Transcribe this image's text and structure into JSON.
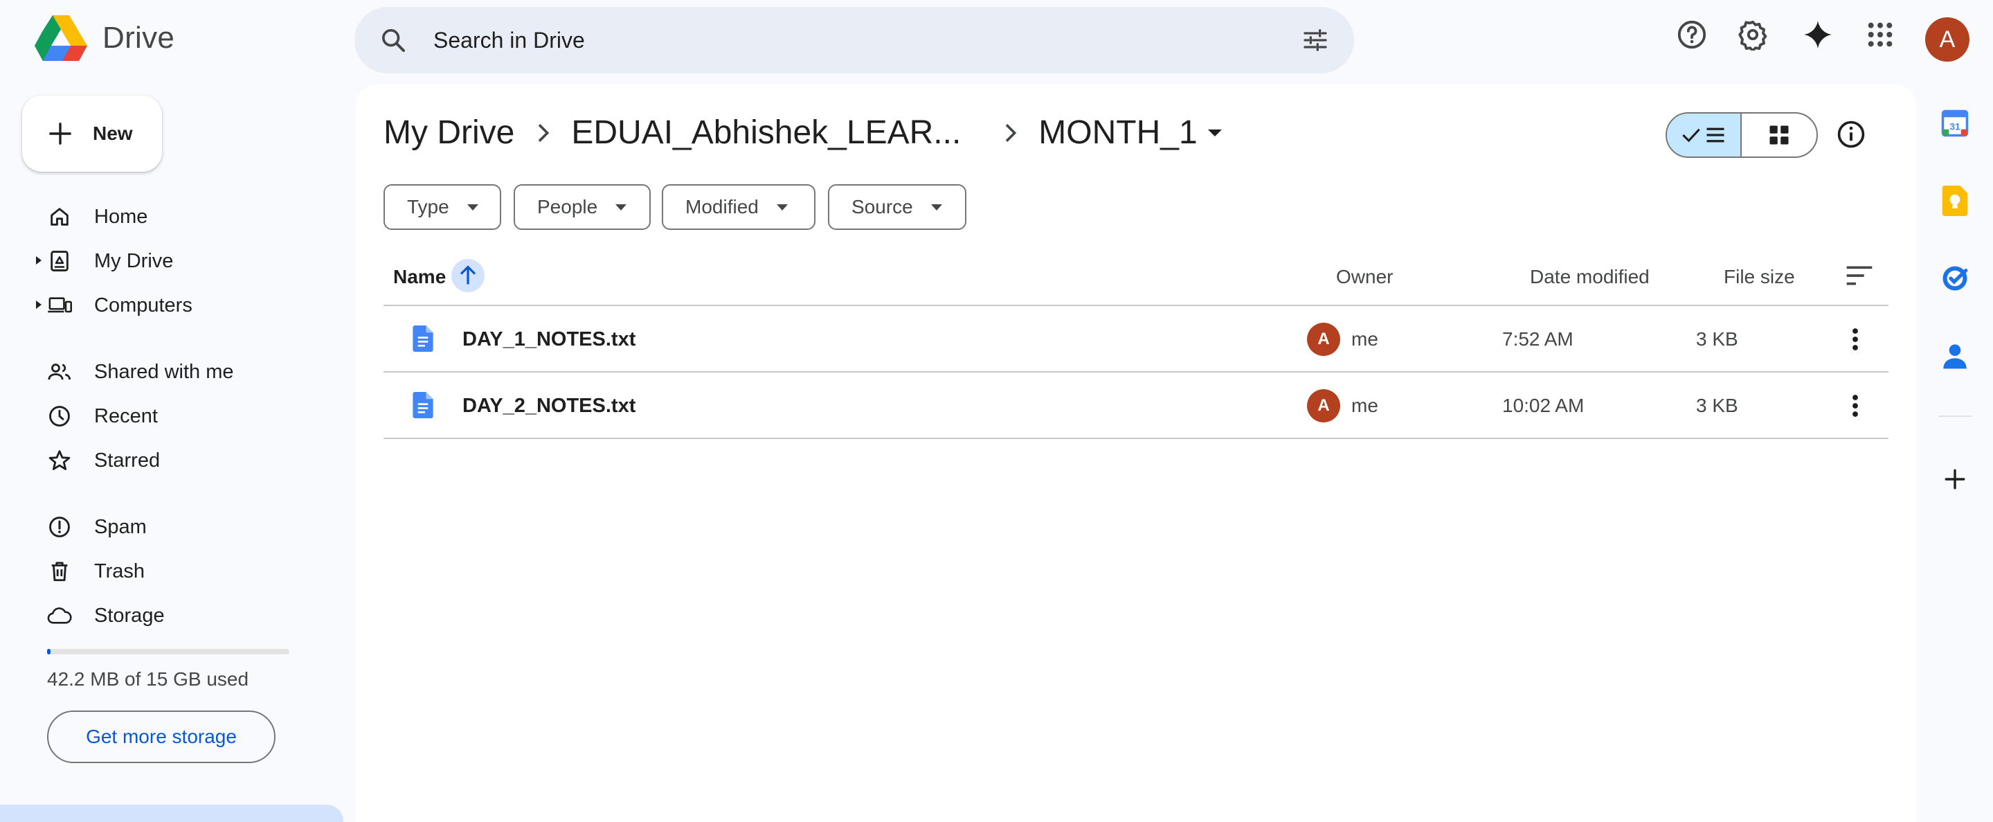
{
  "app": {
    "name": "Drive",
    "colors": {
      "accent": "#0b57d0",
      "selected": "#c2e7ff",
      "avatar": "#b3401f",
      "search_bg": "#e9eef6"
    }
  },
  "header": {
    "search_placeholder": "Search in Drive",
    "user_initial": "A",
    "icons": [
      "search-icon",
      "tune-icon",
      "help-icon",
      "settings-icon",
      "gemini-sparkle-icon",
      "apps-grid-icon"
    ]
  },
  "sidebar": {
    "new_label": "New",
    "items": [
      {
        "label": "Home",
        "icon": "home-icon"
      },
      {
        "label": "My Drive",
        "icon": "my-drive-icon",
        "expandable": true
      },
      {
        "label": "Computers",
        "icon": "computers-icon",
        "expandable": true
      },
      {
        "label": "Shared with me",
        "icon": "people-icon"
      },
      {
        "label": "Recent",
        "icon": "clock-icon"
      },
      {
        "label": "Starred",
        "icon": "star-icon"
      },
      {
        "label": "Spam",
        "icon": "spam-icon"
      },
      {
        "label": "Trash",
        "icon": "trash-icon"
      },
      {
        "label": "Storage",
        "icon": "cloud-icon"
      }
    ],
    "storage": {
      "used_text": "42.2 MB of 15 GB used",
      "used_fraction": 0.003,
      "button_label": "Get more storage"
    }
  },
  "breadcrumb": {
    "root": "My Drive",
    "parent": "EDUAI_Abhishek_LEAR...",
    "current": "MONTH_1"
  },
  "filters": [
    "Type",
    "People",
    "Modified",
    "Source"
  ],
  "table": {
    "columns": {
      "name": "Name",
      "owner": "Owner",
      "modified": "Date modified",
      "size": "File size"
    },
    "rows": [
      {
        "name": "DAY_1_NOTES.txt",
        "owner_initial": "A",
        "owner": "me",
        "modified": "7:52 AM",
        "size": "3 KB"
      },
      {
        "name": "DAY_2_NOTES.txt",
        "owner_initial": "A",
        "owner": "me",
        "modified": "10:02 AM",
        "size": "3 KB"
      }
    ]
  },
  "side_panel": {
    "apps": [
      "calendar-icon",
      "keep-icon",
      "tasks-icon",
      "contacts-icon"
    ],
    "calendar_day": "31"
  }
}
